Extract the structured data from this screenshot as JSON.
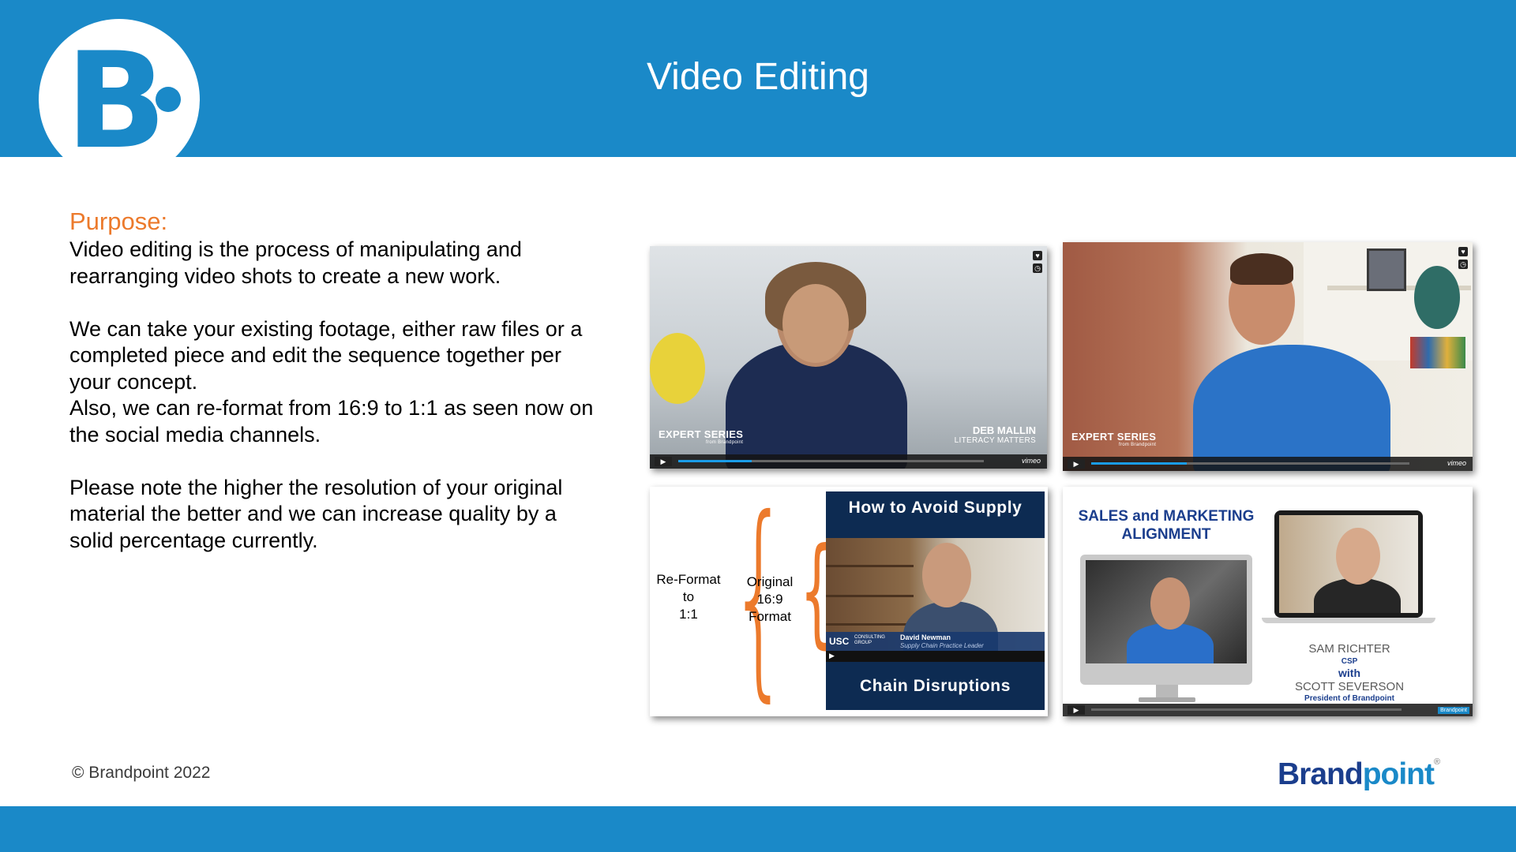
{
  "header": {
    "title": "Video Editing",
    "logo_letter": "B"
  },
  "content": {
    "purpose_label": "Purpose:",
    "paragraphs": [
      "Video editing is the process of manipulating and",
      "rearranging video shots to create a new work.",
      "We can take your existing footage, either raw files or a",
      "completed piece and edit the sequence together per",
      "your concept.",
      "Also, we can re-format from 16:9 to 1:1 as seen now on",
      "the social media channels.",
      "Please note the higher the resolution of your original",
      "material the better and we can increase quality by a",
      "solid percentage currently."
    ]
  },
  "videos": {
    "v1": {
      "series": "EXPERT SERIES",
      "series_sub": "from Brandpoint",
      "name": "DEB MALLIN",
      "org": "LITERACY MATTERS",
      "player_brand": "vimeo"
    },
    "v2": {
      "series": "EXPERT SERIES",
      "series_sub": "from Brandpoint",
      "player_brand": "vimeo"
    },
    "v3": {
      "reformat_label": [
        "Re-Format",
        "to",
        "1:1"
      ],
      "original_label": [
        "Original",
        "16:9",
        "Format"
      ],
      "top_text": "How to Avoid Supply",
      "bottom_text": "Chain Disruptions",
      "usc": "USC",
      "usc_sub": "CONSULTING GROUP",
      "presenter_name": "David Newman",
      "presenter_role": "Supply Chain Practice Leader"
    },
    "v4": {
      "title_line1": "SALES and MARKETING",
      "title_line2": "ALIGNMENT",
      "name1": "SAM RICHTER",
      "name1_title": "CSP",
      "with": "with",
      "name2": "SCOTT SEVERSON",
      "name2_title": "President of Brandpoint",
      "badge": "Brandpoint"
    }
  },
  "footer": {
    "copyright": "© Brandpoint 2022",
    "brand_part1": "Brand",
    "brand_part2": "point",
    "brand_mark": "®"
  },
  "colors": {
    "brand_blue": "#1a89c8",
    "accent_orange": "#ec7a2c",
    "navy": "#1b3e8d"
  },
  "icons": {
    "play": "play-icon",
    "heart": "heart-icon",
    "clock": "clock-icon",
    "settings": "gear-icon"
  }
}
